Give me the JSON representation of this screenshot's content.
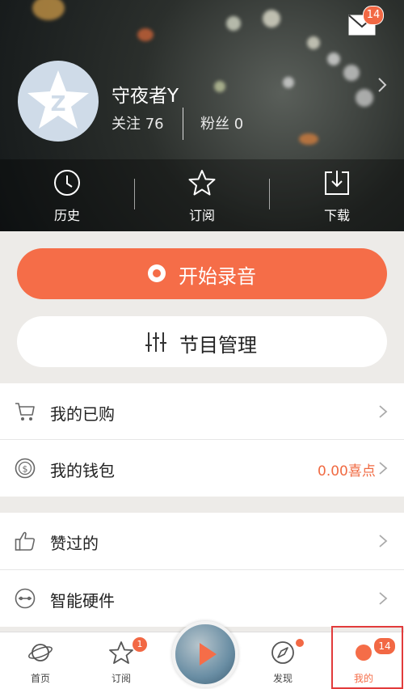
{
  "colors": {
    "accent": "#f56d48",
    "badge": "#f26844",
    "highlight": "#e23b3b"
  },
  "header": {
    "mail_icon": "envelope-icon",
    "mail_badge": "14",
    "username": "守夜者Y",
    "follow_text": "关注 76",
    "fans_text": "粉丝 0"
  },
  "quick_actions": [
    {
      "label": "历史",
      "icon": "clock-icon"
    },
    {
      "label": "订阅",
      "icon": "star-icon"
    },
    {
      "label": "下载",
      "icon": "download-icon"
    }
  ],
  "buttons": {
    "record_label": "开始录音",
    "program_label": "节目管理"
  },
  "menu": [
    {
      "label": "我的已购",
      "icon": "cart-icon",
      "value": ""
    },
    {
      "label": "我的钱包",
      "icon": "coin-icon",
      "value": "0.00喜点"
    },
    {
      "label": "赞过的",
      "icon": "thumbs-up-icon",
      "value": ""
    },
    {
      "label": "智能硬件",
      "icon": "device-icon",
      "value": ""
    }
  ],
  "tabbar": {
    "tabs": [
      {
        "label": "首页",
        "icon": "planet-icon"
      },
      {
        "label": "订阅",
        "icon": "star-icon",
        "badge": "1"
      },
      {
        "label": "发现",
        "icon": "compass-icon"
      },
      {
        "label": "我的",
        "icon": "user-icon",
        "badge": "14"
      }
    ]
  }
}
